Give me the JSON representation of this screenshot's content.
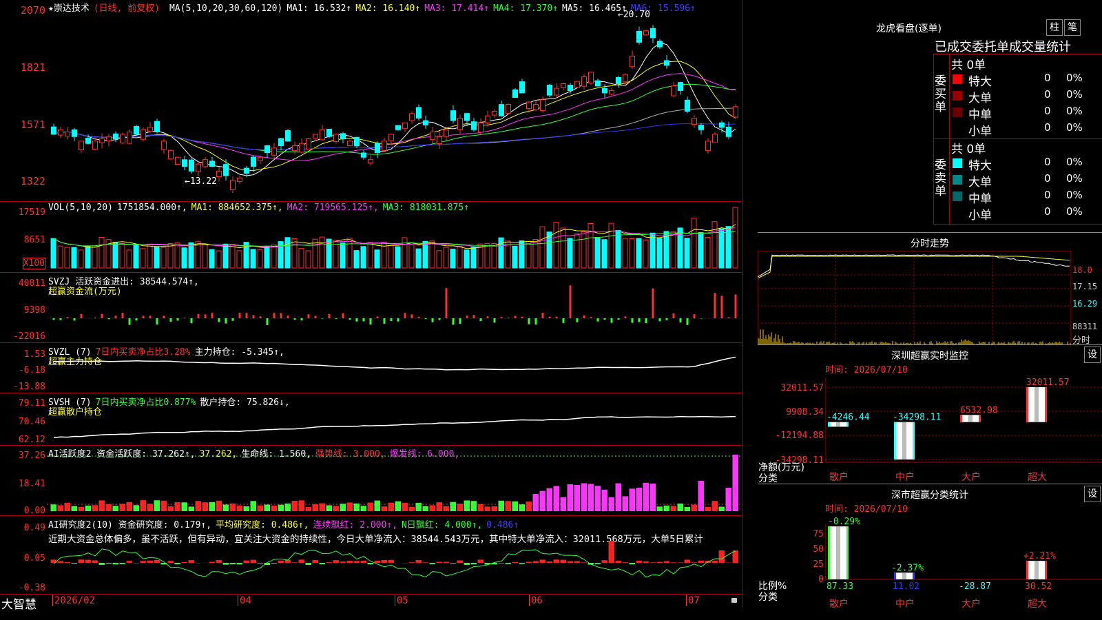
{
  "stock": {
    "name": "★崇达技术",
    "mode": "(日线, 前复权)",
    "ma_header": [
      {
        "t": "MA(5,10,20,30,60,120)",
        "c": "white"
      },
      {
        "t": "MA1: 16.532↑",
        "c": "white"
      },
      {
        "t": "MA2: 16.140↑",
        "c": "yellow"
      },
      {
        "t": "MA3: 17.414↑",
        "c": "mag"
      },
      {
        "t": "MA4: 17.370↑",
        "c": "green"
      },
      {
        "t": "MA5: 16.465↑",
        "c": "white"
      },
      {
        "t": "MA6: 15.596↑",
        "c": "blue"
      }
    ],
    "high_label": "20.70",
    "low_label": "13.22"
  },
  "price_axis": [
    "2070",
    "1821",
    "1571",
    "1322"
  ],
  "vol": {
    "header": [
      {
        "t": "VOL(5,10,20)",
        "c": "white"
      },
      {
        "t": "1751854.000↑,",
        "c": "white"
      },
      {
        "t": "MA1: 884652.375↑,",
        "c": "yellow"
      },
      {
        "t": "MA2: 719565.125↑,",
        "c": "mag"
      },
      {
        "t": "MA3: 818031.875↑",
        "c": "green"
      }
    ],
    "axis": [
      "17519",
      "8651"
    ],
    "unit": "X100"
  },
  "svzj": {
    "header1": "SVZJ  活跃资金进出: 38544.574↑,",
    "header2": "超赢资金流(万元)",
    "axis": [
      "40811",
      "9398",
      "-22016"
    ]
  },
  "svzl": {
    "h_name": "SVZL (7)",
    "h_text": "7日内买卖净占比3.28%",
    "h_val": "主力持仓: -5.345↑,",
    "header2": "超赢主力持仓",
    "axis": [
      "1.53",
      "-6.18",
      "-13.88"
    ]
  },
  "svsh": {
    "h_name": "SVSH (7)",
    "h_text": "7日内买卖净占比0.877%",
    "h_val": "散户持仓: 75.826↓,",
    "header2": "超赢散户持仓",
    "axis": [
      "79.11",
      "70.46",
      "62.12"
    ]
  },
  "ai1": {
    "header": [
      {
        "t": "AI活跃度2 资金活跃度: 37.262↑,",
        "c": "white"
      },
      {
        "t": "37.262,",
        "c": "yellow"
      },
      {
        "t": "生命线: 1.560,",
        "c": "white"
      },
      {
        "t": "强势线: 3.000,",
        "c": "red"
      },
      {
        "t": "爆发线: 6.000,",
        "c": "mag"
      }
    ],
    "axis": [
      "37.26",
      "18.41",
      "0.00"
    ]
  },
  "ai2": {
    "header": [
      {
        "t": "AI研究度2(10) 资金研究度: 0.179↑,",
        "c": "white"
      },
      {
        "t": "平均研究度: 0.486↑,",
        "c": "yellow"
      },
      {
        "t": "连续飘红: 2.000↑,",
        "c": "mag"
      },
      {
        "t": "N日飘红: 4.000↑,",
        "c": "green"
      },
      {
        "t": "0.486↑",
        "c": "blue"
      }
    ],
    "text": "近期大资金总体偏多，虽不活跃，但有异动，宜关注大资金的持续性，今日大单净流入：38544.543万元，其中特大单净流入：32011.568万元，大单5日累计",
    "axis": [
      "0.49",
      "0.05",
      "-0.38"
    ]
  },
  "bottom": {
    "logo": "大智慧",
    "dates": [
      "2026/02",
      "04",
      "05",
      "06",
      "07"
    ]
  },
  "lhb": {
    "title": "龙虎看盘(逐单)",
    "btn1": "柱",
    "btn2": "笔",
    "tabs": "已成交委托单成交量统计",
    "buy_label": "委买单",
    "sell_label": "委卖单",
    "buy_total": "共 0单",
    "sell_total": "共 0单",
    "buy_rows": [
      {
        "name": "特大",
        "n": "0",
        "p": "0%",
        "color": "#ff0000"
      },
      {
        "name": "大单",
        "n": "0",
        "p": "0%",
        "color": "#9a0000"
      },
      {
        "name": "中单",
        "n": "0",
        "p": "0%",
        "color": "#6a0000"
      },
      {
        "name": "小单",
        "n": "0",
        "p": "0%",
        "color": ""
      }
    ],
    "sell_rows": [
      {
        "name": "特大",
        "n": "0",
        "p": "0%",
        "color": "#00ffff"
      },
      {
        "name": "大单",
        "n": "0",
        "p": "0%",
        "color": "#008888"
      },
      {
        "name": "中单",
        "n": "0",
        "p": "0%",
        "color": "#006868"
      },
      {
        "name": "小单",
        "n": "0",
        "p": "0%",
        "color": ""
      }
    ]
  },
  "fenshi": {
    "title": "分时走势",
    "axis": [
      "18.0",
      "17.15",
      "16.29",
      "88311",
      "分时"
    ]
  },
  "monitor": {
    "title": "深圳超赢实时监控",
    "btn": "设",
    "date": "时间: 2026/07/10",
    "ylabel": "净额(万元)",
    "xcat": "分类",
    "axis": [
      "32011.57",
      "9908.34",
      "-12194.88",
      "-34298.11"
    ],
    "categories": [
      "散户",
      "中户",
      "大户",
      "超大"
    ],
    "values_label": [
      "-4246.44",
      "-34298.11",
      "6532.98",
      "32011.57"
    ]
  },
  "stats": {
    "title": "深市超赢分类统计",
    "btn": "设",
    "date": "时间: 2026/07/10",
    "ylabel": "比例%",
    "xcat": "分类",
    "axis": [
      "75",
      "50",
      "25",
      "0"
    ],
    "categories": [
      "散户",
      "中户",
      "大户",
      "超大"
    ],
    "top_labels": [
      "-0.29%",
      "-2.37%",
      "",
      "+2.21%"
    ],
    "bottom_labels": [
      "87.33",
      "11.02",
      "-28.87",
      "30.52"
    ]
  },
  "colors": {
    "up": "#ff3030",
    "down": "#00ffff",
    "border": "#b00000"
  },
  "chart_data": {
    "type": "candlestick",
    "title": "崇达技术 (日线, 前复权)",
    "ylim": [
      13.22,
      20.7
    ],
    "x_labels": [
      "2026/02",
      "04",
      "05",
      "06",
      "07"
    ],
    "daily_up": [
      0,
      1,
      1,
      0,
      1,
      0,
      1,
      1,
      1,
      0,
      1,
      1,
      0,
      1,
      1,
      0,
      1,
      1,
      1,
      0,
      0,
      1,
      1,
      0,
      1,
      0,
      1,
      1,
      0,
      0,
      1,
      0,
      1,
      0,
      0,
      1,
      1,
      1,
      1,
      1,
      0,
      1,
      0,
      1,
      0,
      0,
      1,
      0,
      1,
      1,
      0,
      1,
      1,
      0,
      0,
      1,
      1,
      1,
      0,
      1,
      0,
      0,
      1,
      1,
      1,
      0,
      1,
      0,
      0,
      1,
      1,
      1,
      0,
      1,
      1,
      0,
      1,
      1,
      1,
      0,
      0,
      1,
      0,
      1,
      1,
      0,
      1,
      0,
      0,
      0,
      1,
      0,
      0,
      1,
      0,
      1,
      1,
      0,
      0,
      1
    ],
    "close": [
      15.6,
      15.8,
      15.7,
      15.5,
      15.3,
      15.2,
      15.3,
      15.4,
      15.5,
      15.4,
      15.6,
      15.7,
      15.6,
      15.8,
      15.9,
      15.7,
      15.3,
      14.9,
      14.6,
      14.2,
      14.0,
      14.3,
      14.5,
      14.2,
      14.0,
      13.8,
      13.6,
      13.7,
      13.9,
      14.2,
      14.6,
      14.8,
      15.0,
      15.1,
      15.3,
      15.1,
      15.2,
      15.4,
      15.6,
      15.8,
      15.5,
      15.6,
      15.4,
      15.3,
      15.1,
      14.6,
      14.5,
      14.8,
      15.3,
      15.6,
      15.8,
      16.1,
      16.5,
      16.3,
      16.0,
      15.7,
      15.5,
      15.8,
      16.2,
      16.3,
      16.2,
      15.8,
      16.1,
      16.4,
      16.6,
      16.4,
      16.9,
      17.2,
      17.4,
      17.0,
      16.9,
      17.1,
      17.3,
      17.6,
      17.8,
      17.5,
      17.9,
      18.1,
      18.3,
      17.7,
      17.4,
      17.5,
      17.8,
      18.2,
      19.0,
      19.6,
      20.1,
      19.8,
      19.4,
      18.6,
      17.7,
      17.5,
      16.6,
      16.3,
      15.8,
      15.3,
      15.6,
      15.9,
      15.5,
      16.8
    ]
  }
}
